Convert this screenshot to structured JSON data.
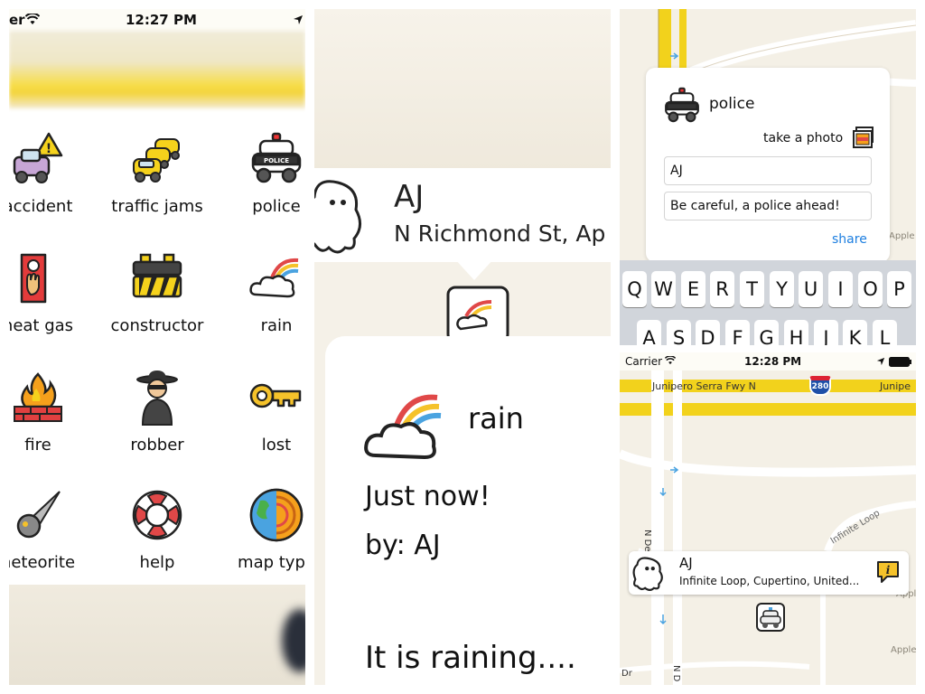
{
  "panel1": {
    "status": {
      "carrier_fragment": "er",
      "time": "12:27 PM"
    },
    "categories": [
      {
        "label": "accident",
        "icon": "accident-car-icon"
      },
      {
        "label": "traffic jams",
        "icon": "traffic-jam-icon"
      },
      {
        "label": "police",
        "icon": "police-car-icon"
      },
      {
        "label": "heat gas",
        "icon": "heat-gas-icon"
      },
      {
        "label": "constructor",
        "icon": "construction-barrier-icon"
      },
      {
        "label": "rain",
        "icon": "rain-cloud-icon"
      },
      {
        "label": "fire",
        "icon": "fire-icon"
      },
      {
        "label": "robber",
        "icon": "robber-icon"
      },
      {
        "label": "lost",
        "icon": "key-icon"
      },
      {
        "label": "neteorite",
        "icon": "meteorite-icon"
      },
      {
        "label": "help",
        "icon": "lifebuoy-icon"
      },
      {
        "label": "map type",
        "icon": "globe-icon"
      }
    ]
  },
  "panel2": {
    "callout": {
      "name": "AJ",
      "address": "N Richmond St, Ap"
    },
    "card": {
      "category": "rain",
      "time": "Just now!",
      "by": "by: AJ",
      "message": "It is raining...."
    }
  },
  "panel3": {
    "category": "police",
    "take_photo_label": "take a photo",
    "name_value": "AJ",
    "message_value": "Be careful, a police ahead!",
    "share_label": "share",
    "map_label": "Apple",
    "keyboard_row1": [
      "Q",
      "W",
      "E",
      "R",
      "T",
      "Y",
      "U",
      "I",
      "O",
      "P"
    ],
    "keyboard_row2": [
      "A",
      "S",
      "D",
      "F",
      "G",
      "H",
      "J",
      "K",
      "L"
    ]
  },
  "panel4": {
    "status": {
      "carrier": "Carrier",
      "time": "12:28 PM"
    },
    "map": {
      "freeway_label": "Junipero Serra Fwy N",
      "freeway_label_right": "Junipe",
      "interstate_shield": "280",
      "street_vertical": "N De Anza",
      "street_diag": "Infinite Loop",
      "map_label_right": "Appl",
      "map_label_bottom": "Apple",
      "frag_dr": "Dr",
      "frag_n": "N D"
    },
    "pin": {
      "name": "AJ",
      "address": "Infinite Loop, Cupertino, United..."
    }
  },
  "colors": {
    "yellow_road": "#f2d21c",
    "share_blue": "#1e7fe0",
    "map_bg": "#f4f0e6"
  }
}
